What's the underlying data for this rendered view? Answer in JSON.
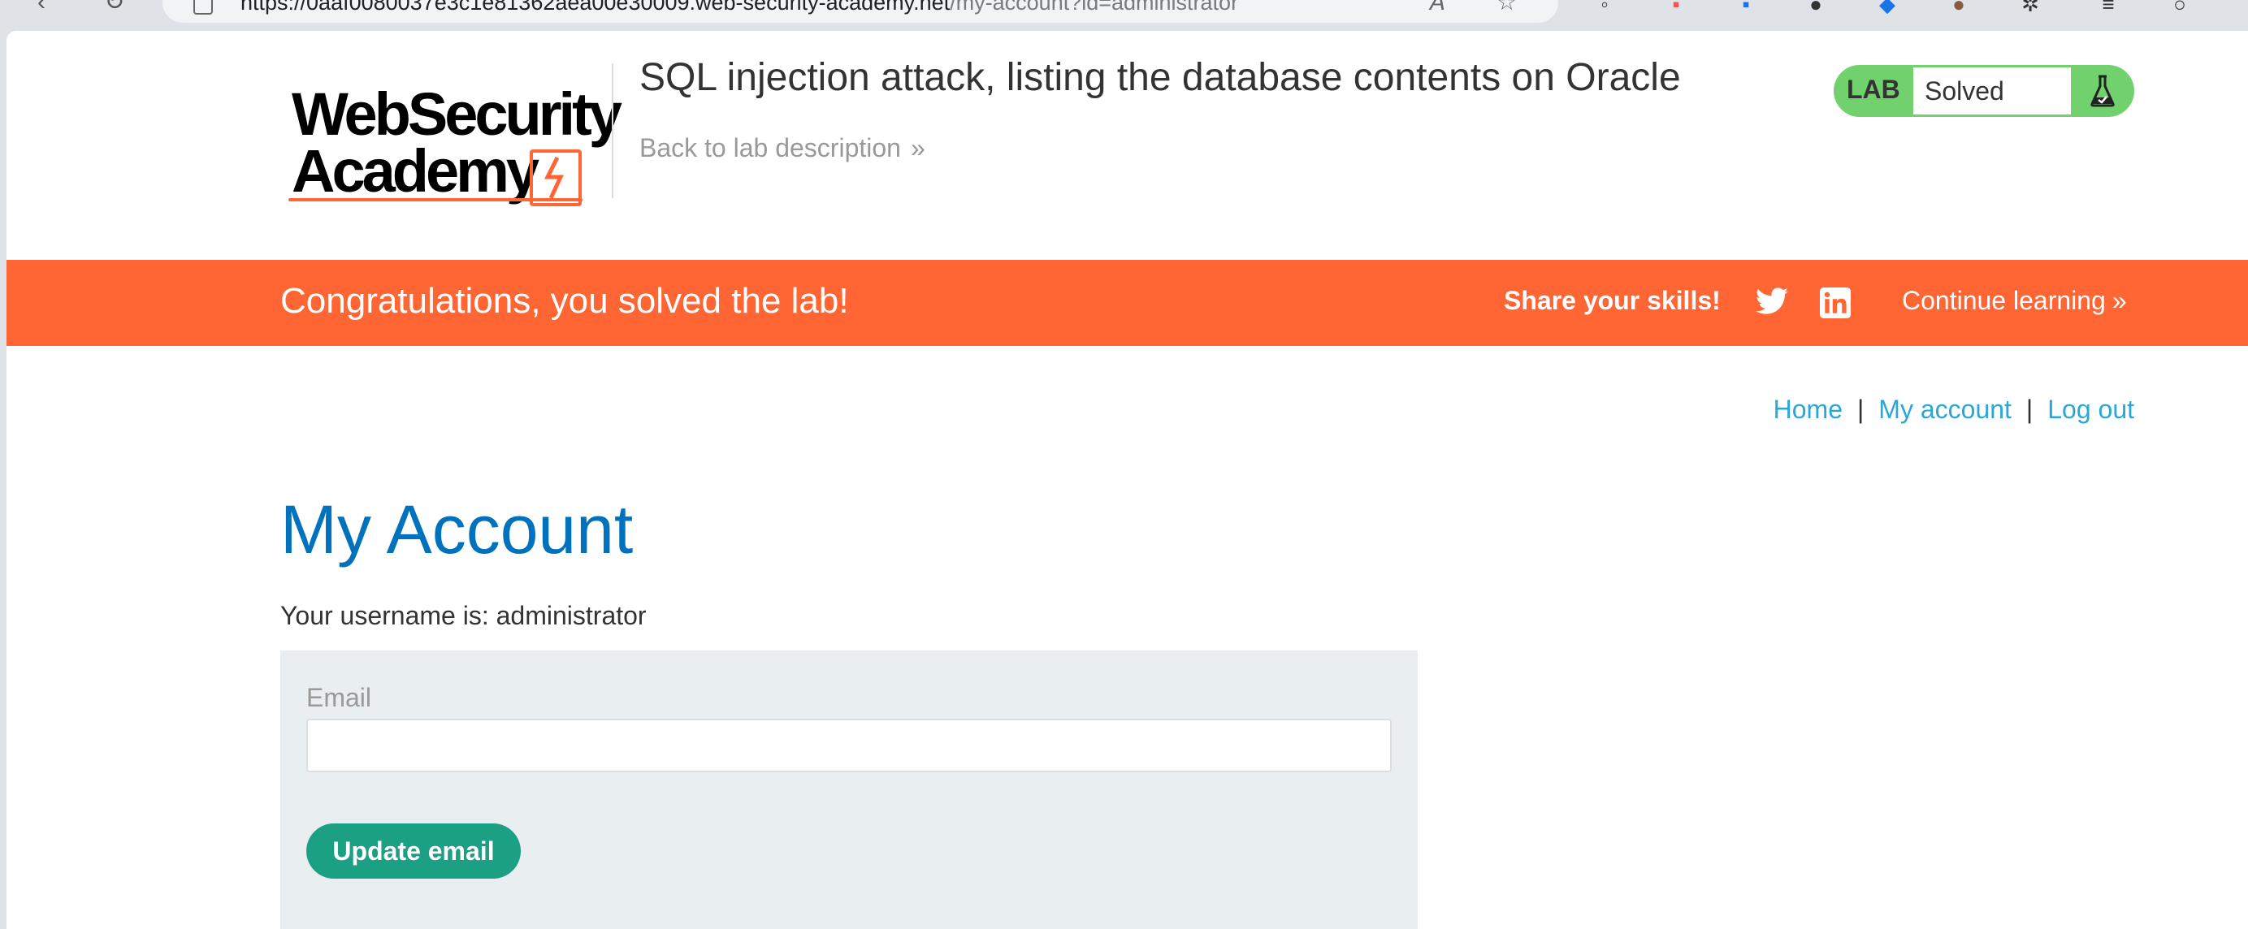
{
  "browser": {
    "url_host": "https://0aaf0080037e3c1e81362aea00e30009.web-security-academy.net",
    "url_path": "/my-account?id=administrator",
    "icons": [
      "back-icon",
      "reload-icon",
      "site-info-icon",
      "read-aloud-icon",
      "favorite-icon"
    ]
  },
  "header": {
    "logo_line1": "WebSecurity",
    "logo_line2": "Academy",
    "lab_title": "SQL injection attack, listing the database contents on Oracle",
    "back_link": "Back to lab description",
    "back_chevron": "»",
    "lab_badge_label": "LAB",
    "lab_status": "Solved"
  },
  "banner": {
    "message": "Congratulations, you solved the lab!",
    "share_label": "Share your skills!",
    "continue_label": "Continue learning",
    "continue_chevron": "»",
    "color": "#ff6633"
  },
  "nav": {
    "home": "Home",
    "separator": "|",
    "my_account": "My account",
    "log_out": "Log out"
  },
  "main": {
    "title": "My Account",
    "username_text": "Your username is: administrator",
    "email_label": "Email",
    "email_value": "",
    "update_button": "Update email"
  },
  "colors": {
    "link": "#29a7d8",
    "title": "#0071bc",
    "button": "#1ba083",
    "badge": "#70d16d"
  }
}
